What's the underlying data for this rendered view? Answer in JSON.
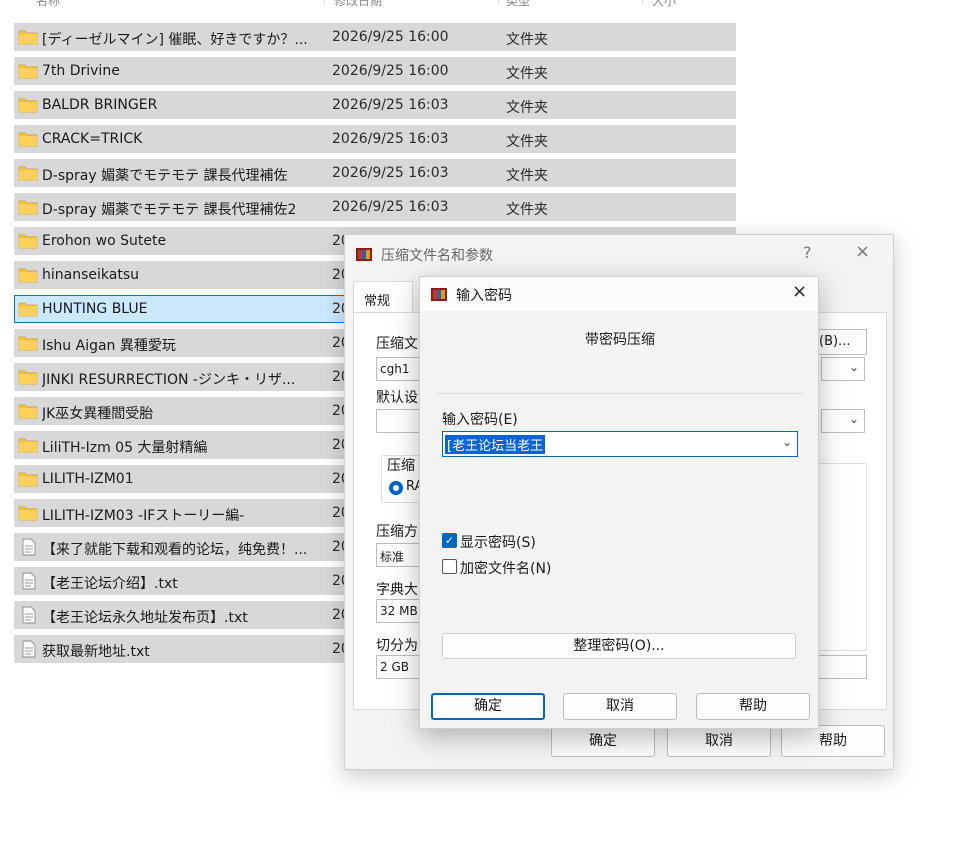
{
  "explorer": {
    "columns": [
      "名称",
      "修改日期",
      "类型",
      "大小"
    ],
    "files": [
      {
        "name": "[ディーゼルマイン] 催眠、好きですか？...",
        "date": "2026/9/25 16:00",
        "type": "文件夹",
        "icon": "folder"
      },
      {
        "name": "7th Drivine",
        "date": "2026/9/25 16:00",
        "type": "文件夹",
        "icon": "folder"
      },
      {
        "name": "BALDR BRINGER",
        "date": "2026/9/25 16:03",
        "type": "文件夹",
        "icon": "folder"
      },
      {
        "name": "CRACK=TRICK",
        "date": "2026/9/25 16:03",
        "type": "文件夹",
        "icon": "folder"
      },
      {
        "name": "D-spray 媚薬でモテモテ 課長代理補佐",
        "date": "2026/9/25 16:03",
        "type": "文件夹",
        "icon": "folder"
      },
      {
        "name": "D-spray 媚薬でモテモテ 課長代理補佐2",
        "date": "2026/9/25 16:03",
        "type": "文件夹",
        "icon": "folder"
      },
      {
        "name": "Erohon wo Sutete",
        "date": "2026/9/25 16:03",
        "type": "文件夹",
        "icon": "folder"
      },
      {
        "name": "hinanseikatsu",
        "date": "20",
        "type": "",
        "icon": "folder"
      },
      {
        "name": "HUNTING BLUE",
        "date": "20",
        "type": "",
        "icon": "folder",
        "selected": true
      },
      {
        "name": "Ishu Aigan 異種愛玩",
        "date": "20",
        "type": "",
        "icon": "folder"
      },
      {
        "name": "JINKI RESURRECTION -ジンキ・リザ...",
        "date": "20",
        "type": "",
        "icon": "folder"
      },
      {
        "name": "JK巫女異種閻受胎",
        "date": "20",
        "type": "",
        "icon": "folder"
      },
      {
        "name": "LiliTH-Izm 05 大量射精編",
        "date": "20",
        "type": "",
        "icon": "folder"
      },
      {
        "name": "LILITH-IZM01",
        "date": "20",
        "type": "",
        "icon": "folder"
      },
      {
        "name": "LILITH-IZM03 -IFストーリー編-",
        "date": "20",
        "type": "",
        "icon": "folder"
      },
      {
        "name": "【来了就能下载和观看的论坛，纯免费！...",
        "date": "20",
        "type": "",
        "icon": "file"
      },
      {
        "name": "【老王论坛介绍】.txt",
        "date": "20",
        "type": "",
        "icon": "file"
      },
      {
        "name": "【老王论坛永久地址发布页】.txt",
        "date": "20",
        "type": "",
        "icon": "file"
      },
      {
        "name": "获取最新地址.txt",
        "date": "20",
        "type": "",
        "icon": "file"
      }
    ]
  },
  "archive_dialog": {
    "title": "压缩文件名和参数",
    "help": "?",
    "close": "×",
    "tab_general": "常规",
    "archive_name_label": "压缩文",
    "archive_name_value": "cgh1",
    "browse_label": "(B)...",
    "default_profile_label": "默认设",
    "format_label": "压缩",
    "format_radio_label": "RA",
    "method_label": "压缩方",
    "method_value": "标准",
    "dict_label": "字典大",
    "dict_value": "32 MB",
    "split_label": "切分为",
    "split_value": "2 GB",
    "ok": "确定",
    "cancel": "取消",
    "help_button": "帮助"
  },
  "password_dialog": {
    "title": "输入密码",
    "close": "×",
    "heading": "带密码压缩",
    "input_label": "输入密码(E)",
    "password_value": "[老王论坛当老王",
    "show_password_label": "显示密码(S)",
    "show_password_checked": true,
    "encrypt_names_label": "加密文件名(N)",
    "encrypt_names_checked": false,
    "organize_label": "整理密码(O)...",
    "ok": "确定",
    "cancel": "取消",
    "help": "帮助"
  },
  "colors": {
    "row_bg": "#d8d8d8",
    "selected_bg": "#cce8ff",
    "accent": "#0067c0",
    "folder": "#f6c33c",
    "selection_highlight": "#0a64d6"
  }
}
